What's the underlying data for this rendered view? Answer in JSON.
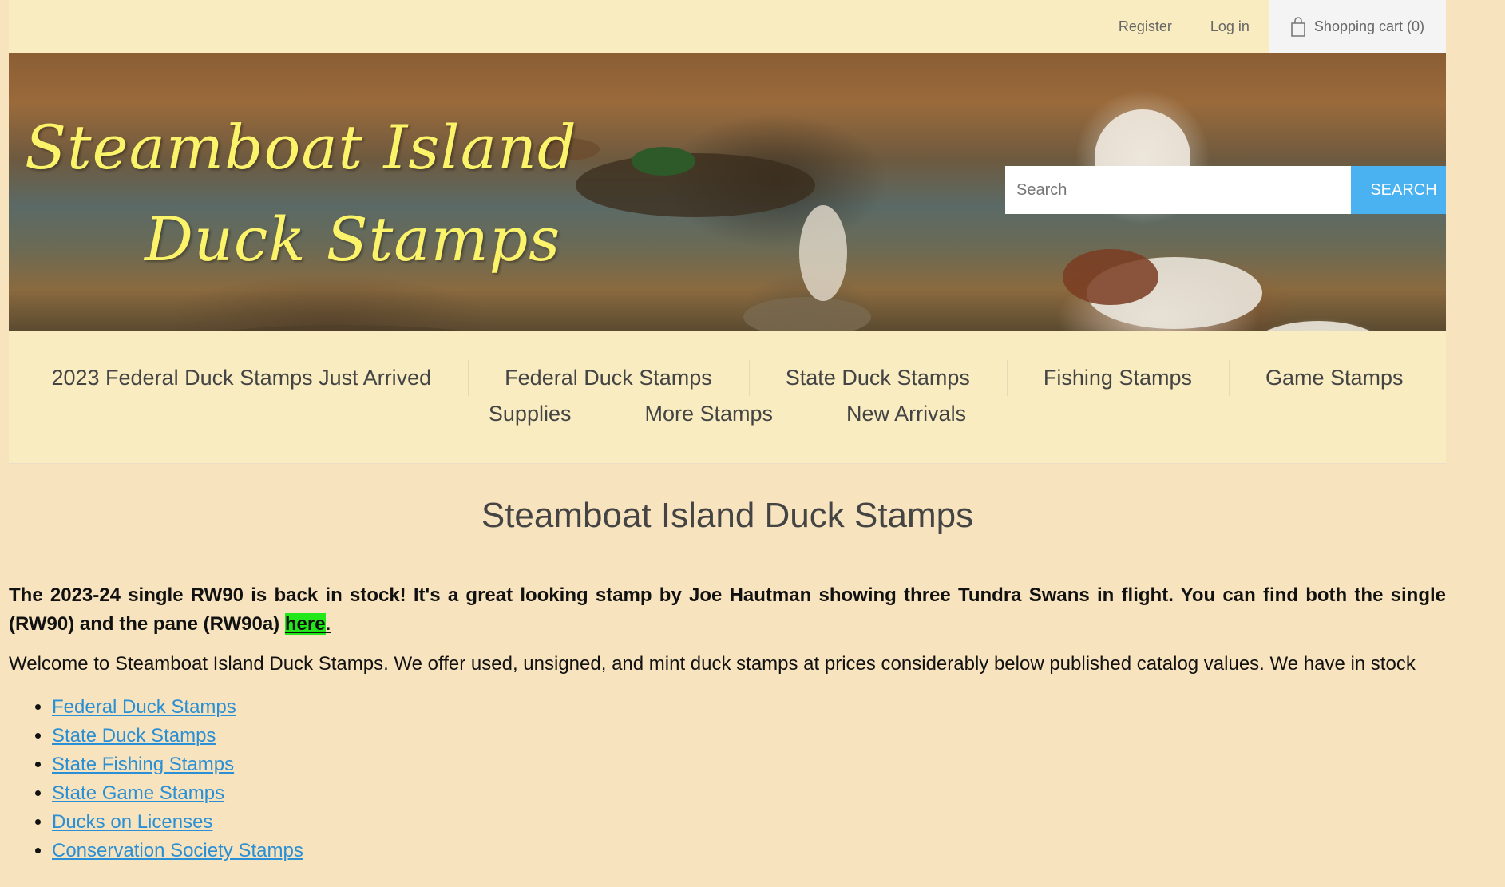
{
  "header": {
    "register": "Register",
    "login": "Log in",
    "cart": "Shopping cart (0)"
  },
  "banner": {
    "title_line1": "Steamboat Island",
    "title_line2": "Duck Stamps"
  },
  "search": {
    "placeholder": "Search",
    "button": "SEARCH"
  },
  "nav": {
    "row1": [
      "2023 Federal Duck Stamps Just Arrived",
      "Federal Duck Stamps",
      "State Duck Stamps",
      "Fishing Stamps",
      "Game Stamps"
    ],
    "row2": [
      "Supplies",
      "More Stamps",
      "New Arrivals"
    ]
  },
  "main": {
    "title": "Steamboat Island Duck Stamps",
    "notice_text": "The 2023-24 single RW90 is back in stock!  It's a great looking stamp by Joe Hautman showing three Tundra Swans in flight.  You can find both the single (RW90) and the pane (RW90a) ",
    "notice_link": "here",
    "notice_end": ".",
    "welcome": "Welcome to Steamboat Island Duck Stamps.  We offer used, unsigned, and mint duck stamps at prices considerably below published catalog values.  We have in stock",
    "links": [
      "Federal Duck Stamps",
      "State Duck Stamps",
      "State Fishing Stamps",
      "State Game Stamps",
      "Ducks on Licenses",
      "Conservation Society Stamps"
    ]
  },
  "colors": {
    "page_bg": "#f7e3bd",
    "header_bg": "#f8ecc0",
    "search_button": "#4ab2f1",
    "highlight": "#22e81a",
    "link": "#2a8fd5",
    "title_yellow": "#fbf36a"
  }
}
